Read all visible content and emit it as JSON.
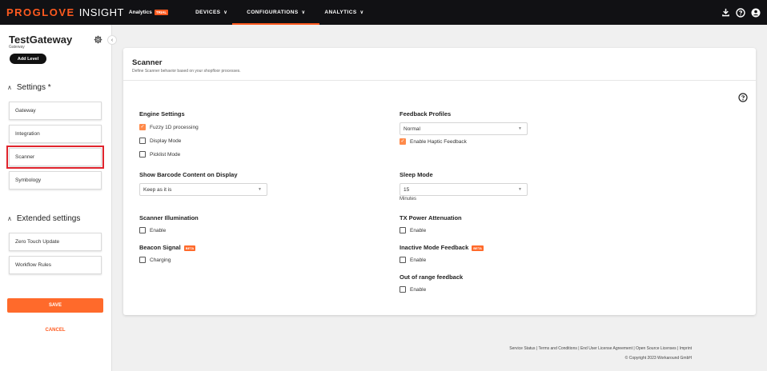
{
  "brand": {
    "pro": "PROGLOVE",
    "insight": "INSIGHT",
    "analytics": "Analytics",
    "trial": "TRIAL"
  },
  "nav": [
    {
      "label": "DEVICES"
    },
    {
      "label": "CONFIGURATIONS"
    },
    {
      "label": "ANALYTICS"
    }
  ],
  "top_icons": [
    "download-icon",
    "help-icon",
    "account-icon"
  ],
  "sidebar": {
    "title": "TestGateway",
    "subtitle": "Gateway",
    "add_level": "Add Level",
    "settings_heading": "Settings *",
    "settings_items": [
      "Gateway",
      "Integration",
      "Scanner",
      "Symbology"
    ],
    "selected_item": "Scanner",
    "extended_heading": "Extended settings",
    "extended_items": [
      "Zero Touch Update",
      "Workflow Rules"
    ],
    "save": "SAVE",
    "cancel": "CANCEL"
  },
  "card": {
    "title": "Scanner",
    "description": "Define Scanner behavior based on your shopfloor processes.",
    "engine": {
      "label": "Engine Settings",
      "options": [
        {
          "label": "Fuzzy 1D processing",
          "checked": true
        },
        {
          "label": "Display Mode",
          "checked": false
        },
        {
          "label": "Picklist Mode",
          "checked": false
        }
      ]
    },
    "barcode_display": {
      "label": "Show Barcode Content on Display",
      "value": "Keep as it is"
    },
    "illumination": {
      "label": "Scanner Illumination",
      "option": "Enable",
      "checked": false
    },
    "beacon": {
      "label": "Beacon Signal",
      "badge": "BETA",
      "option": "Charging",
      "checked": false
    },
    "feedback": {
      "label": "Feedback Profiles",
      "value": "Normal",
      "option": "Enable Haptic Feedback",
      "checked": true
    },
    "sleep": {
      "label": "Sleep Mode",
      "value": "15",
      "helper": "Minutes"
    },
    "tx_power": {
      "label": "TX Power Attenuation",
      "option": "Enable",
      "checked": false
    },
    "inactive": {
      "label": "Inactive Mode Feedback",
      "badge": "BETA",
      "option": "Enable",
      "checked": false
    },
    "out_of_range": {
      "label": "Out of range feedback",
      "option": "Enable",
      "checked": false
    }
  },
  "footer": {
    "links": "Service Status | Terms and Conditions | End User License Agreement | Open Source Licenses | Imprint",
    "copyright": "© Copyright 2023 Workaround GmbH"
  },
  "colors": {
    "accent": "#ff5a1f",
    "topbar": "#111114",
    "selection_outline": "#e0242d"
  }
}
